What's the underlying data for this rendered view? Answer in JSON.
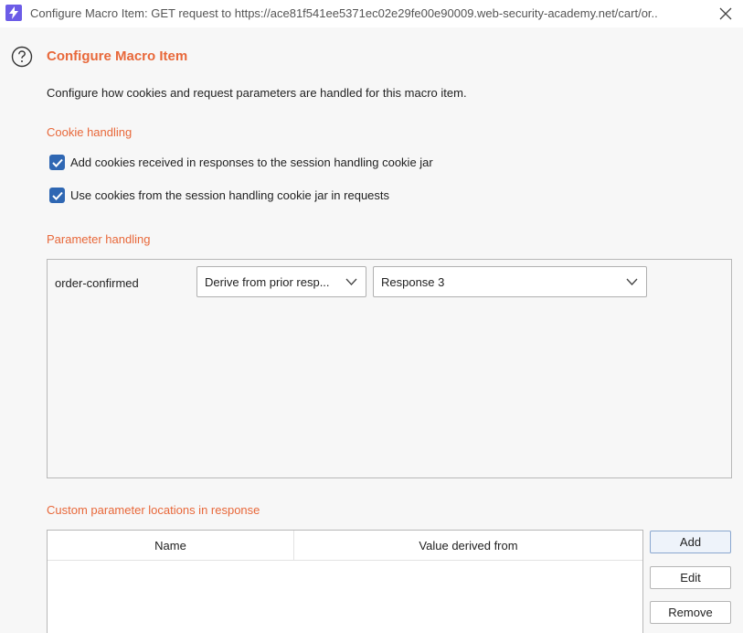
{
  "window": {
    "title": "Configure Macro Item: GET request to https://ace81f541ee5371ec02e29fe00e90009.web-security-academy.net/cart/or..",
    "app_icon": "burp-lightning-icon",
    "accent_color": "#6c5ce7"
  },
  "header": {
    "title": "Configure Macro Item",
    "description": "Configure how cookies and request parameters are handled for this macro item.",
    "title_color": "#e8683a"
  },
  "cookie_handling": {
    "section_title": "Cookie handling",
    "options": [
      {
        "label": "Add cookies received in responses to the session handling cookie jar",
        "checked": true
      },
      {
        "label": "Use cookies from the session handling cookie jar in requests",
        "checked": true
      }
    ]
  },
  "parameter_handling": {
    "section_title": "Parameter handling",
    "rows": [
      {
        "name": "order-confirmed",
        "mode": "Derive from prior resp...",
        "source": "Response 3"
      }
    ]
  },
  "custom_locations": {
    "section_title": "Custom parameter locations in response",
    "columns": [
      "Name",
      "Value derived from"
    ],
    "rows": [],
    "buttons": {
      "add": "Add",
      "edit": "Edit",
      "remove": "Remove"
    }
  }
}
